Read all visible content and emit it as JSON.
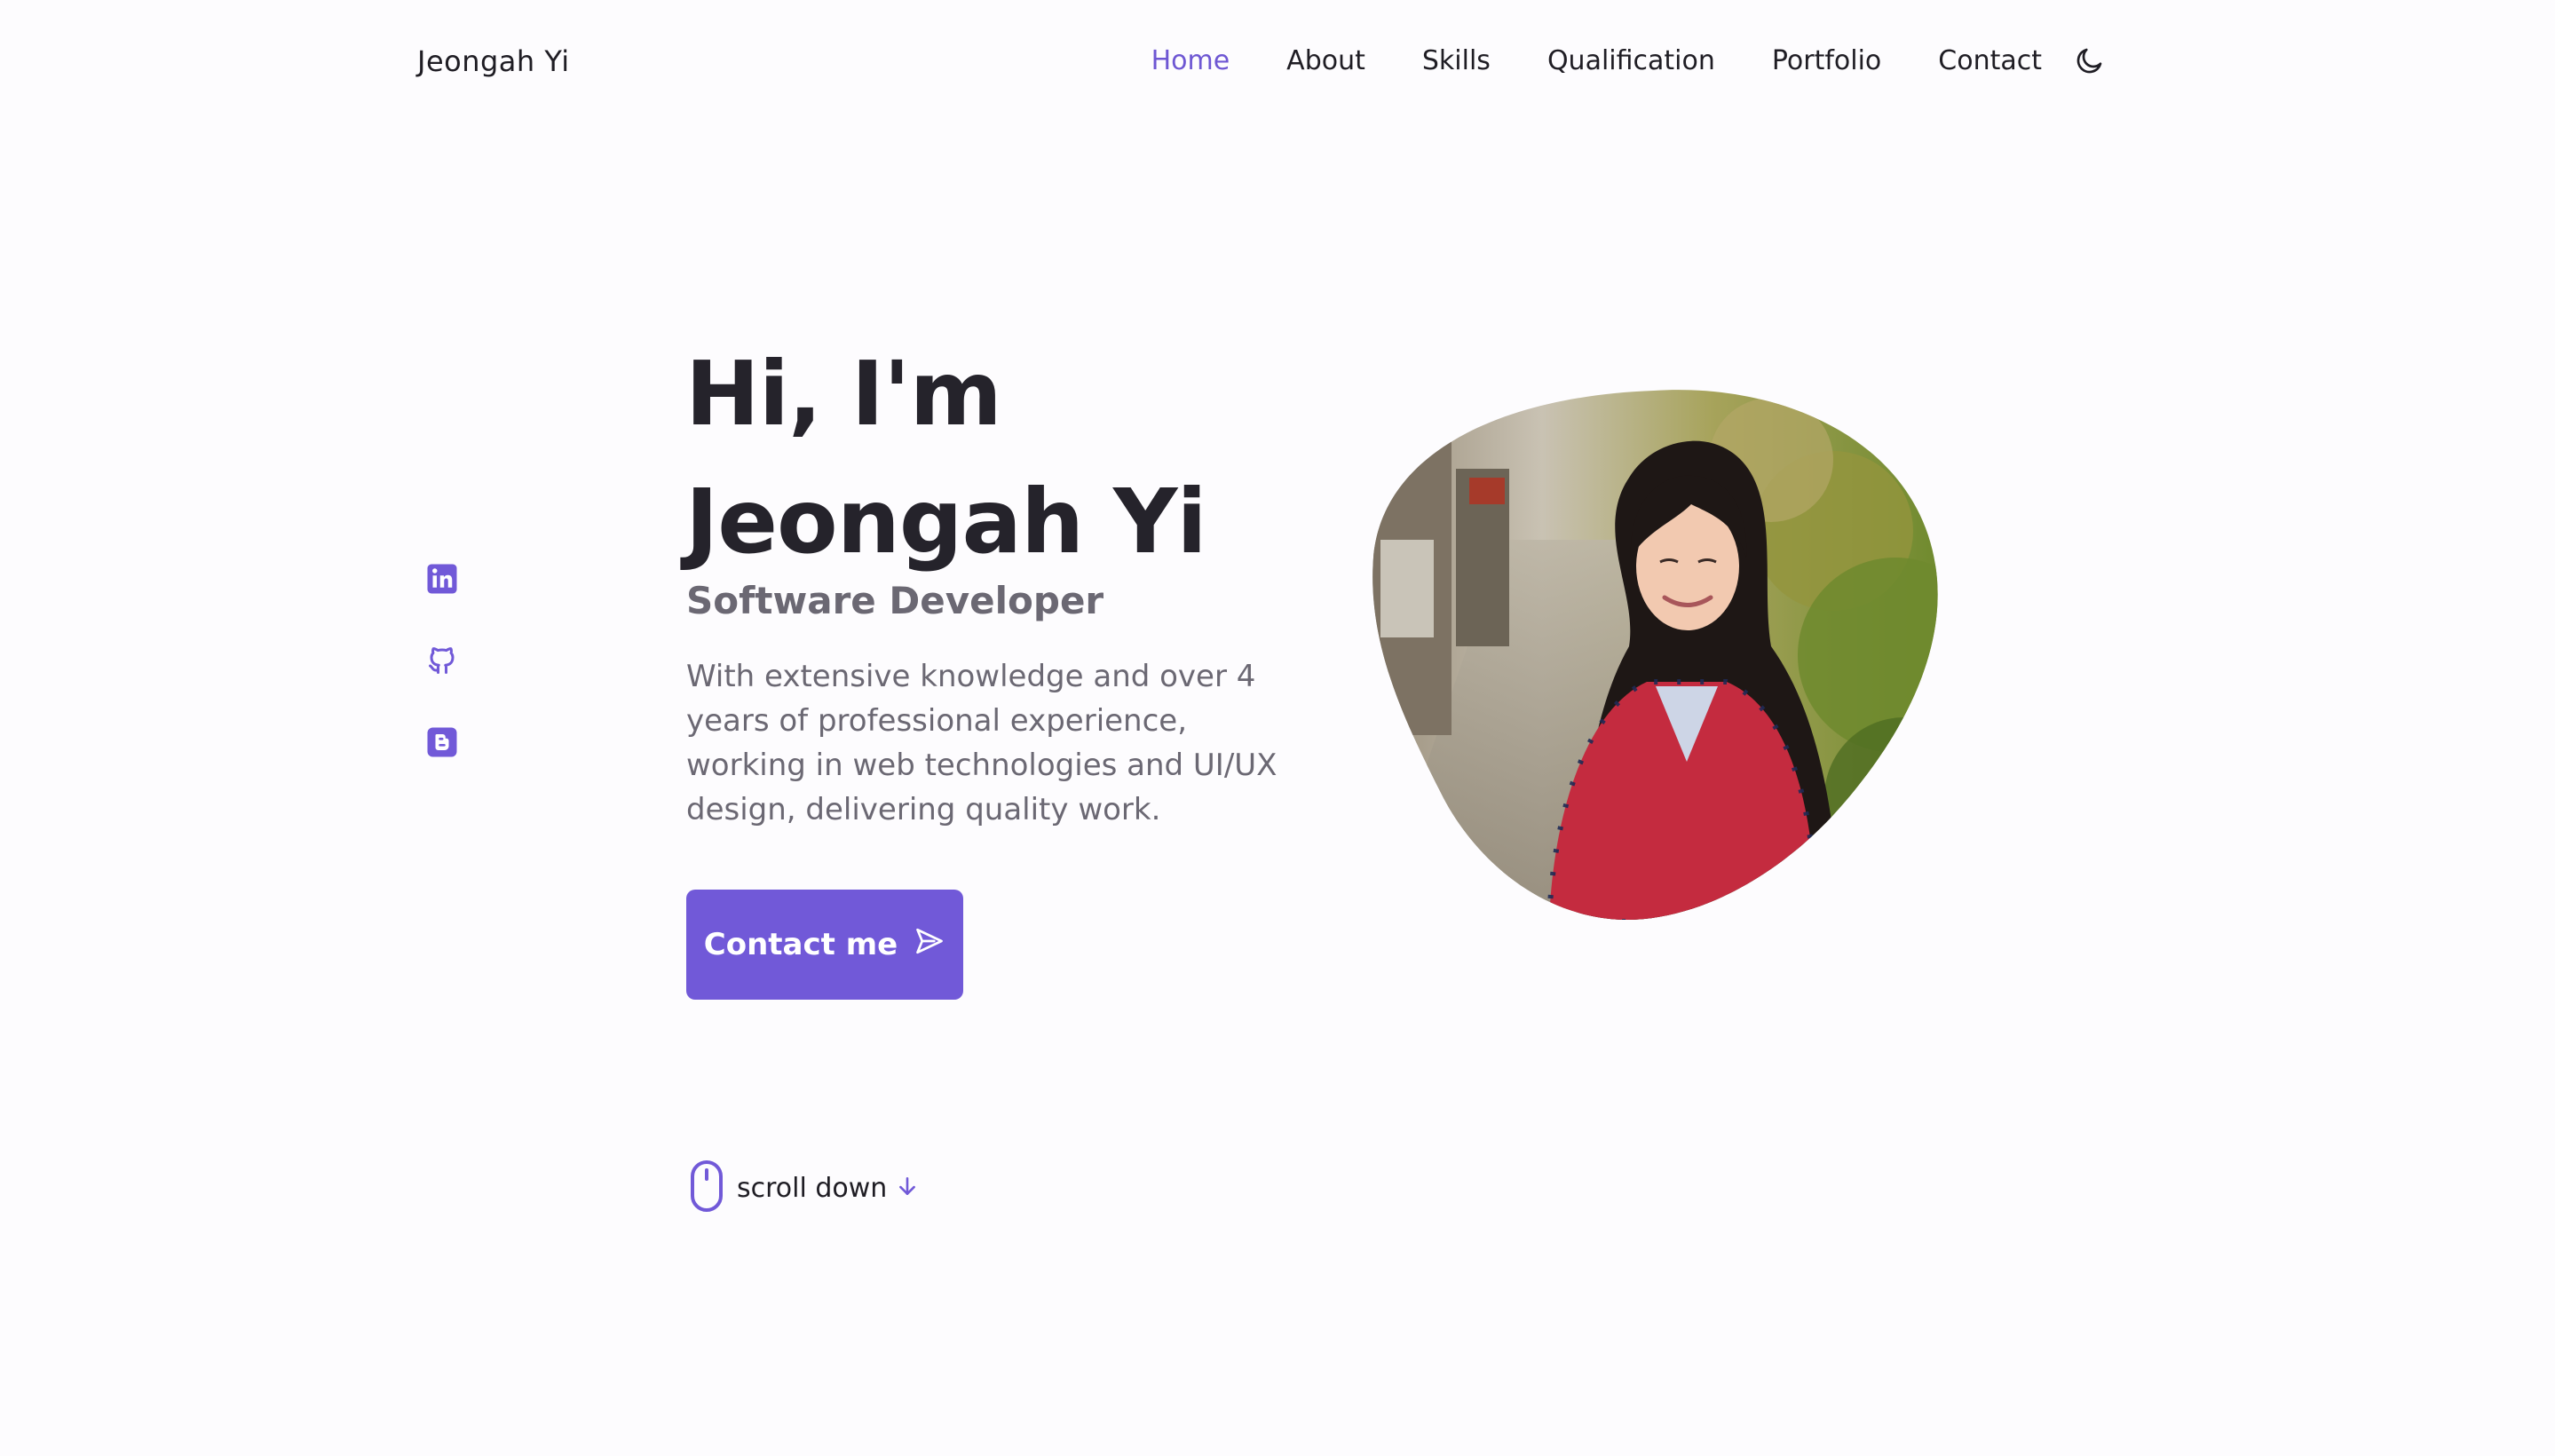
{
  "header": {
    "logo": "Jeongah Yi",
    "nav": [
      {
        "label": "Home",
        "active": true
      },
      {
        "label": "About",
        "active": false
      },
      {
        "label": "Skills",
        "active": false
      },
      {
        "label": "Qualification",
        "active": false
      },
      {
        "label": "Portfolio",
        "active": false
      },
      {
        "label": "Contact",
        "active": false
      }
    ],
    "theme_icon": "moon-icon"
  },
  "socials": [
    "linkedin-icon",
    "github-icon",
    "blogger-icon"
  ],
  "hero": {
    "title_line1": "Hi, I'm",
    "title_line2": "Jeongah Yi",
    "subtitle": "Software Developer",
    "description": "With extensive knowledge and over 4 years of professional experience, working in web technologies and UI/UX design, delivering quality work.",
    "cta_label": "Contact me",
    "cta_icon": "send-icon"
  },
  "scroll": {
    "label": "scroll down",
    "icon": "mouse-icon",
    "arrow_icon": "arrow-down-icon"
  },
  "colors": {
    "accent": "#7159d8",
    "active_nav": "#6e57d3",
    "title": "#25232b",
    "text": "#6b6873",
    "background": "#fdfcfe"
  }
}
